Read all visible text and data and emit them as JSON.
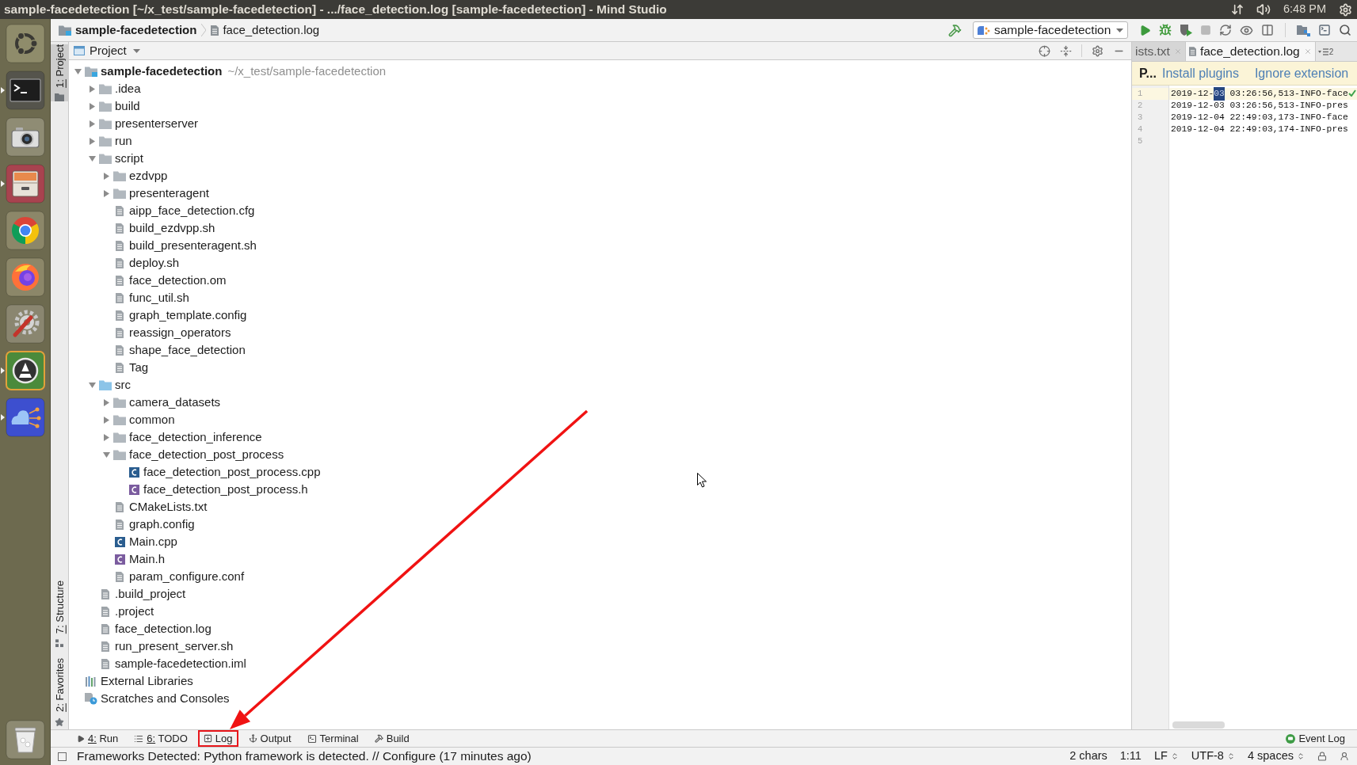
{
  "window": {
    "title": "sample-facedetection [~/x_test/sample-facedetection] - .../face_detection.log [sample-facedetection] - Mind Studio"
  },
  "top_panel": {
    "clock": "6:48 PM"
  },
  "launcher": [
    {
      "kind": "dash",
      "running": false
    },
    {
      "kind": "terminal",
      "running": true
    },
    {
      "kind": "camera",
      "running": false
    },
    {
      "kind": "files",
      "running": true
    },
    {
      "kind": "chrome",
      "running": false
    },
    {
      "kind": "firefox",
      "running": false
    },
    {
      "kind": "settings",
      "running": false
    },
    {
      "kind": "updater",
      "running": true
    },
    {
      "kind": "mindstudio",
      "running": true
    },
    {
      "kind": "trash",
      "running": false
    }
  ],
  "navigation_bar": {
    "breadcrumbs": [
      {
        "kind": "module",
        "label": "sample-facedetection"
      },
      {
        "kind": "file",
        "label": "face_detection.log"
      }
    ],
    "toolbar": [
      {
        "kind": "build",
        "disabled": false
      },
      {
        "kind": "run_config",
        "label": "sample-facedetection"
      },
      {
        "kind": "run",
        "disabled": false
      },
      {
        "kind": "debug",
        "disabled": false
      },
      {
        "kind": "coverage",
        "disabled": false
      },
      {
        "kind": "stop",
        "disabled": true
      },
      {
        "kind": "sync",
        "disabled": false
      },
      {
        "kind": "watch",
        "disabled": false
      },
      {
        "kind": "split",
        "disabled": false
      },
      {
        "kind": "separator"
      },
      {
        "kind": "structure",
        "disabled": false
      },
      {
        "kind": "terminal",
        "disabled": false
      },
      {
        "kind": "search",
        "disabled": false
      }
    ]
  },
  "tool_stripe": {
    "top": [
      {
        "kind": "project",
        "label": "1: Project",
        "selected": true,
        "mnemonic": true
      }
    ],
    "bottom": [
      {
        "kind": "structure",
        "label": "7: Structure",
        "selected": false,
        "mnemonic": true
      },
      {
        "kind": "favorites",
        "label": "2: Favorites",
        "selected": false,
        "mnemonic": true
      }
    ]
  },
  "project_panel": {
    "title": "Project",
    "tree": [
      {
        "kind": "module",
        "label": "sample-facedetection",
        "location": "~/x_test/sample-facedetection",
        "expanded": true,
        "children": [
          {
            "kind": "folder",
            "label": ".idea",
            "expanded": false
          },
          {
            "kind": "folder",
            "label": "build",
            "expanded": false
          },
          {
            "kind": "folder",
            "label": "presenterserver",
            "expanded": false
          },
          {
            "kind": "folder",
            "label": "run",
            "expanded": false
          },
          {
            "kind": "folder",
            "label": "script",
            "expanded": true,
            "children": [
              {
                "kind": "folder",
                "label": "ezdvpp",
                "expanded": false
              },
              {
                "kind": "folder",
                "label": "presenteragent",
                "expanded": false
              },
              {
                "kind": "file",
                "label": "aipp_face_detection.cfg"
              },
              {
                "kind": "file",
                "label": "build_ezdvpp.sh"
              },
              {
                "kind": "file",
                "label": "build_presenteragent.sh"
              },
              {
                "kind": "file",
                "label": "deploy.sh"
              },
              {
                "kind": "file",
                "label": "face_detection.om"
              },
              {
                "kind": "file",
                "label": "func_util.sh"
              },
              {
                "kind": "file",
                "label": "graph_template.config"
              },
              {
                "kind": "file",
                "label": "reassign_operators"
              },
              {
                "kind": "file",
                "label": "shape_face_detection"
              },
              {
                "kind": "file",
                "label": "Tag"
              }
            ]
          },
          {
            "kind": "source_folder",
            "label": "src",
            "expanded": true,
            "children": [
              {
                "kind": "folder",
                "label": "camera_datasets",
                "expanded": false
              },
              {
                "kind": "folder",
                "label": "common",
                "expanded": false
              },
              {
                "kind": "folder",
                "label": "face_detection_inference",
                "expanded": false
              },
              {
                "kind": "folder",
                "label": "face_detection_post_process",
                "expanded": true,
                "children": [
                  {
                    "kind": "cpp",
                    "label": "face_detection_post_process.cpp"
                  },
                  {
                    "kind": "header",
                    "label": "face_detection_post_process.h"
                  }
                ]
              },
              {
                "kind": "file",
                "label": "CMakeLists.txt"
              },
              {
                "kind": "file",
                "label": "graph.config"
              },
              {
                "kind": "cpp",
                "label": "Main.cpp"
              },
              {
                "kind": "header",
                "label": "Main.h"
              },
              {
                "kind": "file",
                "label": "param_configure.conf"
              }
            ]
          },
          {
            "kind": "file",
            "label": ".build_project"
          },
          {
            "kind": "file",
            "label": ".project"
          },
          {
            "kind": "file",
            "label": "face_detection.log"
          },
          {
            "kind": "file",
            "label": "run_present_server.sh"
          },
          {
            "kind": "file",
            "label": "sample-facedetection.iml"
          }
        ]
      },
      {
        "kind": "library",
        "label": "External Libraries"
      },
      {
        "kind": "scratches",
        "label": "Scratches and Consoles"
      }
    ]
  },
  "editor": {
    "tabs": [
      {
        "kind": "clipped",
        "label": "ists.txt",
        "selected": false
      },
      {
        "kind": "file",
        "label": "face_detection.log",
        "selected": true
      }
    ],
    "hidden_tab_count": "2",
    "banner": {
      "message": "P...",
      "actions": [
        "Install plugins",
        "Ignore extension"
      ]
    },
    "lines": [
      {
        "number": "1",
        "current": true,
        "segments": [
          {
            "text": "2019-12-",
            "selected": false
          },
          {
            "text": "03",
            "selected": true
          },
          {
            "text": " 03:26:56,513-INFO-face",
            "selected": false
          }
        ]
      },
      {
        "number": "2",
        "current": false,
        "segments": [
          {
            "text": "2019-12-03 03:26:56,513-INFO-pres",
            "selected": false
          }
        ]
      },
      {
        "number": "3",
        "current": false,
        "segments": [
          {
            "text": "2019-12-04 22:49:03,173-INFO-face",
            "selected": false
          }
        ]
      },
      {
        "number": "4",
        "current": false,
        "segments": [
          {
            "text": "2019-12-04 22:49:03,174-INFO-pres",
            "selected": false
          }
        ]
      },
      {
        "number": "5",
        "current": false
      }
    ]
  },
  "bottom_bar": {
    "tool_windows": [
      {
        "kind": "run",
        "label": "4: Run",
        "mnemonic": true,
        "highlighted": false
      },
      {
        "kind": "todo",
        "label": "6: TODO",
        "mnemonic": true,
        "highlighted": false
      },
      {
        "kind": "log",
        "label": "Log",
        "mnemonic": false,
        "highlighted": true
      },
      {
        "kind": "output",
        "label": "Output",
        "mnemonic": false,
        "highlighted": false
      },
      {
        "kind": "terminal",
        "label": "Terminal",
        "mnemonic": false,
        "highlighted": false
      },
      {
        "kind": "build",
        "label": "Build",
        "mnemonic": false,
        "highlighted": false
      }
    ],
    "event_log": "Event Log"
  },
  "status_bar": {
    "message": "Frameworks Detected: Python framework is detected. // Configure (17 minutes ago)",
    "widgets": [
      {
        "label": "2 chars",
        "dropdown": false
      },
      {
        "label": "1:11",
        "dropdown": false
      },
      {
        "label": "LF",
        "dropdown": true
      },
      {
        "label": "UTF-8",
        "dropdown": true
      },
      {
        "label": "4 spaces",
        "dropdown": true
      }
    ]
  }
}
